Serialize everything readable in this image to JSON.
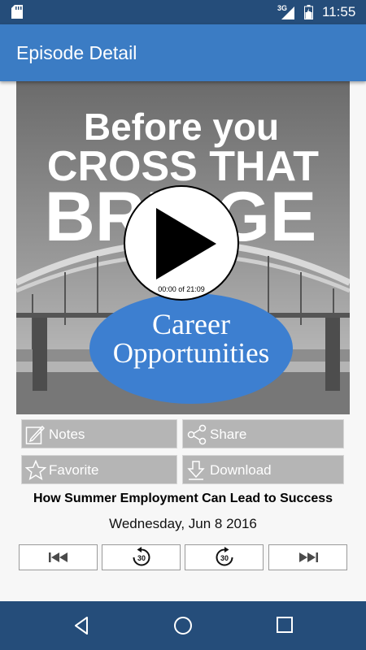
{
  "status_bar": {
    "network": "3G",
    "time": "11:55"
  },
  "app_bar": {
    "title": "Episode Detail"
  },
  "artwork": {
    "line1": "Before you",
    "line2": "CROSS THAT",
    "line3": "BRIDGE",
    "badge_line1": "Career",
    "badge_line2": "Opportunities"
  },
  "player": {
    "elapsed": "00:00 of 21:09"
  },
  "actions": {
    "notes": "Notes",
    "share": "Share",
    "favorite": "Favorite",
    "download": "Download"
  },
  "episode": {
    "title": "How Summer Employment Can Lead to Success",
    "date": "Wednesday, Jun 8 2016"
  },
  "controls": {
    "skip_seconds": "30"
  },
  "colors": {
    "app_bar": "#3b7cc4",
    "status_bar": "#254d7a",
    "badge": "#3d7fd0"
  }
}
